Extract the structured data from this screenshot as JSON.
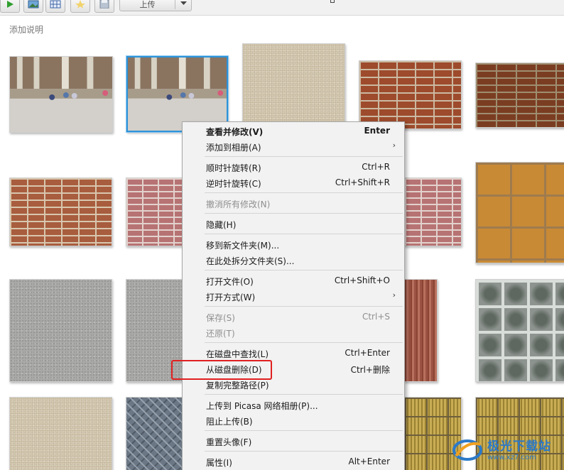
{
  "toolbar": {
    "upload_label": "上传"
  },
  "caption": "添加说明",
  "context_menu": {
    "items": [
      {
        "label": "查看并修改(V)",
        "shortcut": "Enter"
      },
      {
        "label": "添加到相册(A)",
        "shortcut": ""
      },
      {
        "label": "顺时针旋转(R)",
        "shortcut": "Ctrl+R"
      },
      {
        "label": "逆时针旋转(C)",
        "shortcut": "Ctrl+Shift+R"
      },
      {
        "label": "撤消所有修改(N)",
        "shortcut": ""
      },
      {
        "label": "隐藏(H)",
        "shortcut": ""
      },
      {
        "label": "移到新文件夹(M)...",
        "shortcut": ""
      },
      {
        "label": "在此处拆分文件夹(S)...",
        "shortcut": ""
      },
      {
        "label": "打开文件(O)",
        "shortcut": "Ctrl+Shift+O"
      },
      {
        "label": "打开方式(W)",
        "shortcut": ""
      },
      {
        "label": "保存(S)",
        "shortcut": "Ctrl+S"
      },
      {
        "label": "还原(T)",
        "shortcut": ""
      },
      {
        "label": "在磁盘中查找(L)",
        "shortcut": "Ctrl+Enter"
      },
      {
        "label": "从磁盘删除(D)",
        "shortcut": "Ctrl+删除"
      },
      {
        "label": "复制完整路径(P)",
        "shortcut": ""
      },
      {
        "label": "上传到 Picasa 网络相册(P)...",
        "shortcut": ""
      },
      {
        "label": "阻止上传(B)",
        "shortcut": ""
      },
      {
        "label": "重置头像(F)",
        "shortcut": ""
      },
      {
        "label": "属性(I)",
        "shortcut": "Alt+Enter"
      }
    ],
    "disabled_items": [
      "撤消所有修改(N)",
      "保存(S)",
      "还原(T)"
    ],
    "highlighted_item": "从磁盘删除(D)",
    "highlight_color": "#e02020"
  },
  "watermark": {
    "line1": "极光下载站",
    "line2": "www.xz7.com"
  },
  "colors": {
    "selection_border": "#2d92d8",
    "menu_background": "#f2f2f2"
  }
}
